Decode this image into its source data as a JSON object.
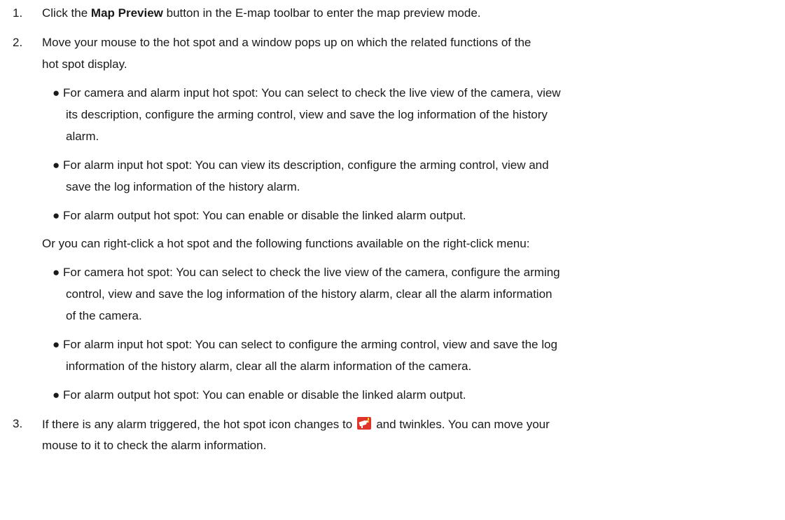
{
  "steps": [
    {
      "number": "1.",
      "pre": "Click the ",
      "bold": "Map Preview",
      "post": " button in the E-map toolbar to enter the map preview mode."
    },
    {
      "number": "2.",
      "line1": "Move your mouse to the hot spot and a window pops up on which the related functions of the",
      "line2": "hot spot display.",
      "bullets": [
        {
          "lines": [
            "● For camera and alarm input hot spot: You can select to check the live view of the camera, view",
            "its description, configure the arming control, view and save the log information of the history",
            "alarm."
          ]
        },
        {
          "lines": [
            "● For alarm input hot spot: You can view its description, configure the arming control, view and",
            "save the log information of the history alarm."
          ]
        },
        {
          "lines": [
            "● For alarm output hot spot: You can enable or disable the linked alarm output."
          ]
        }
      ],
      "or_line": "Or you can right-click a hot spot and the following functions available on the right-click menu:",
      "bullets2": [
        {
          "lines": [
            "● For camera hot spot: You can select to check the live view of the camera, configure the arming",
            "control, view and save the log information of the history alarm, clear all the alarm information",
            "of the camera."
          ]
        },
        {
          "lines": [
            "● For alarm input hot spot: You can select to configure the arming control, view and save the log",
            "information of the history alarm, clear all the alarm information of the camera."
          ]
        },
        {
          "lines": [
            "● For alarm output hot spot: You can enable or disable the linked alarm output."
          ]
        }
      ]
    },
    {
      "number": "3.",
      "line1_pre": "If there is any alarm triggered, the hot spot icon changes to",
      "line1_post": "and twinkles. You can move your",
      "line2": "mouse to it to check the alarm information.",
      "icon": "alarm-camera-icon",
      "icon_color": "#e0342a"
    }
  ]
}
